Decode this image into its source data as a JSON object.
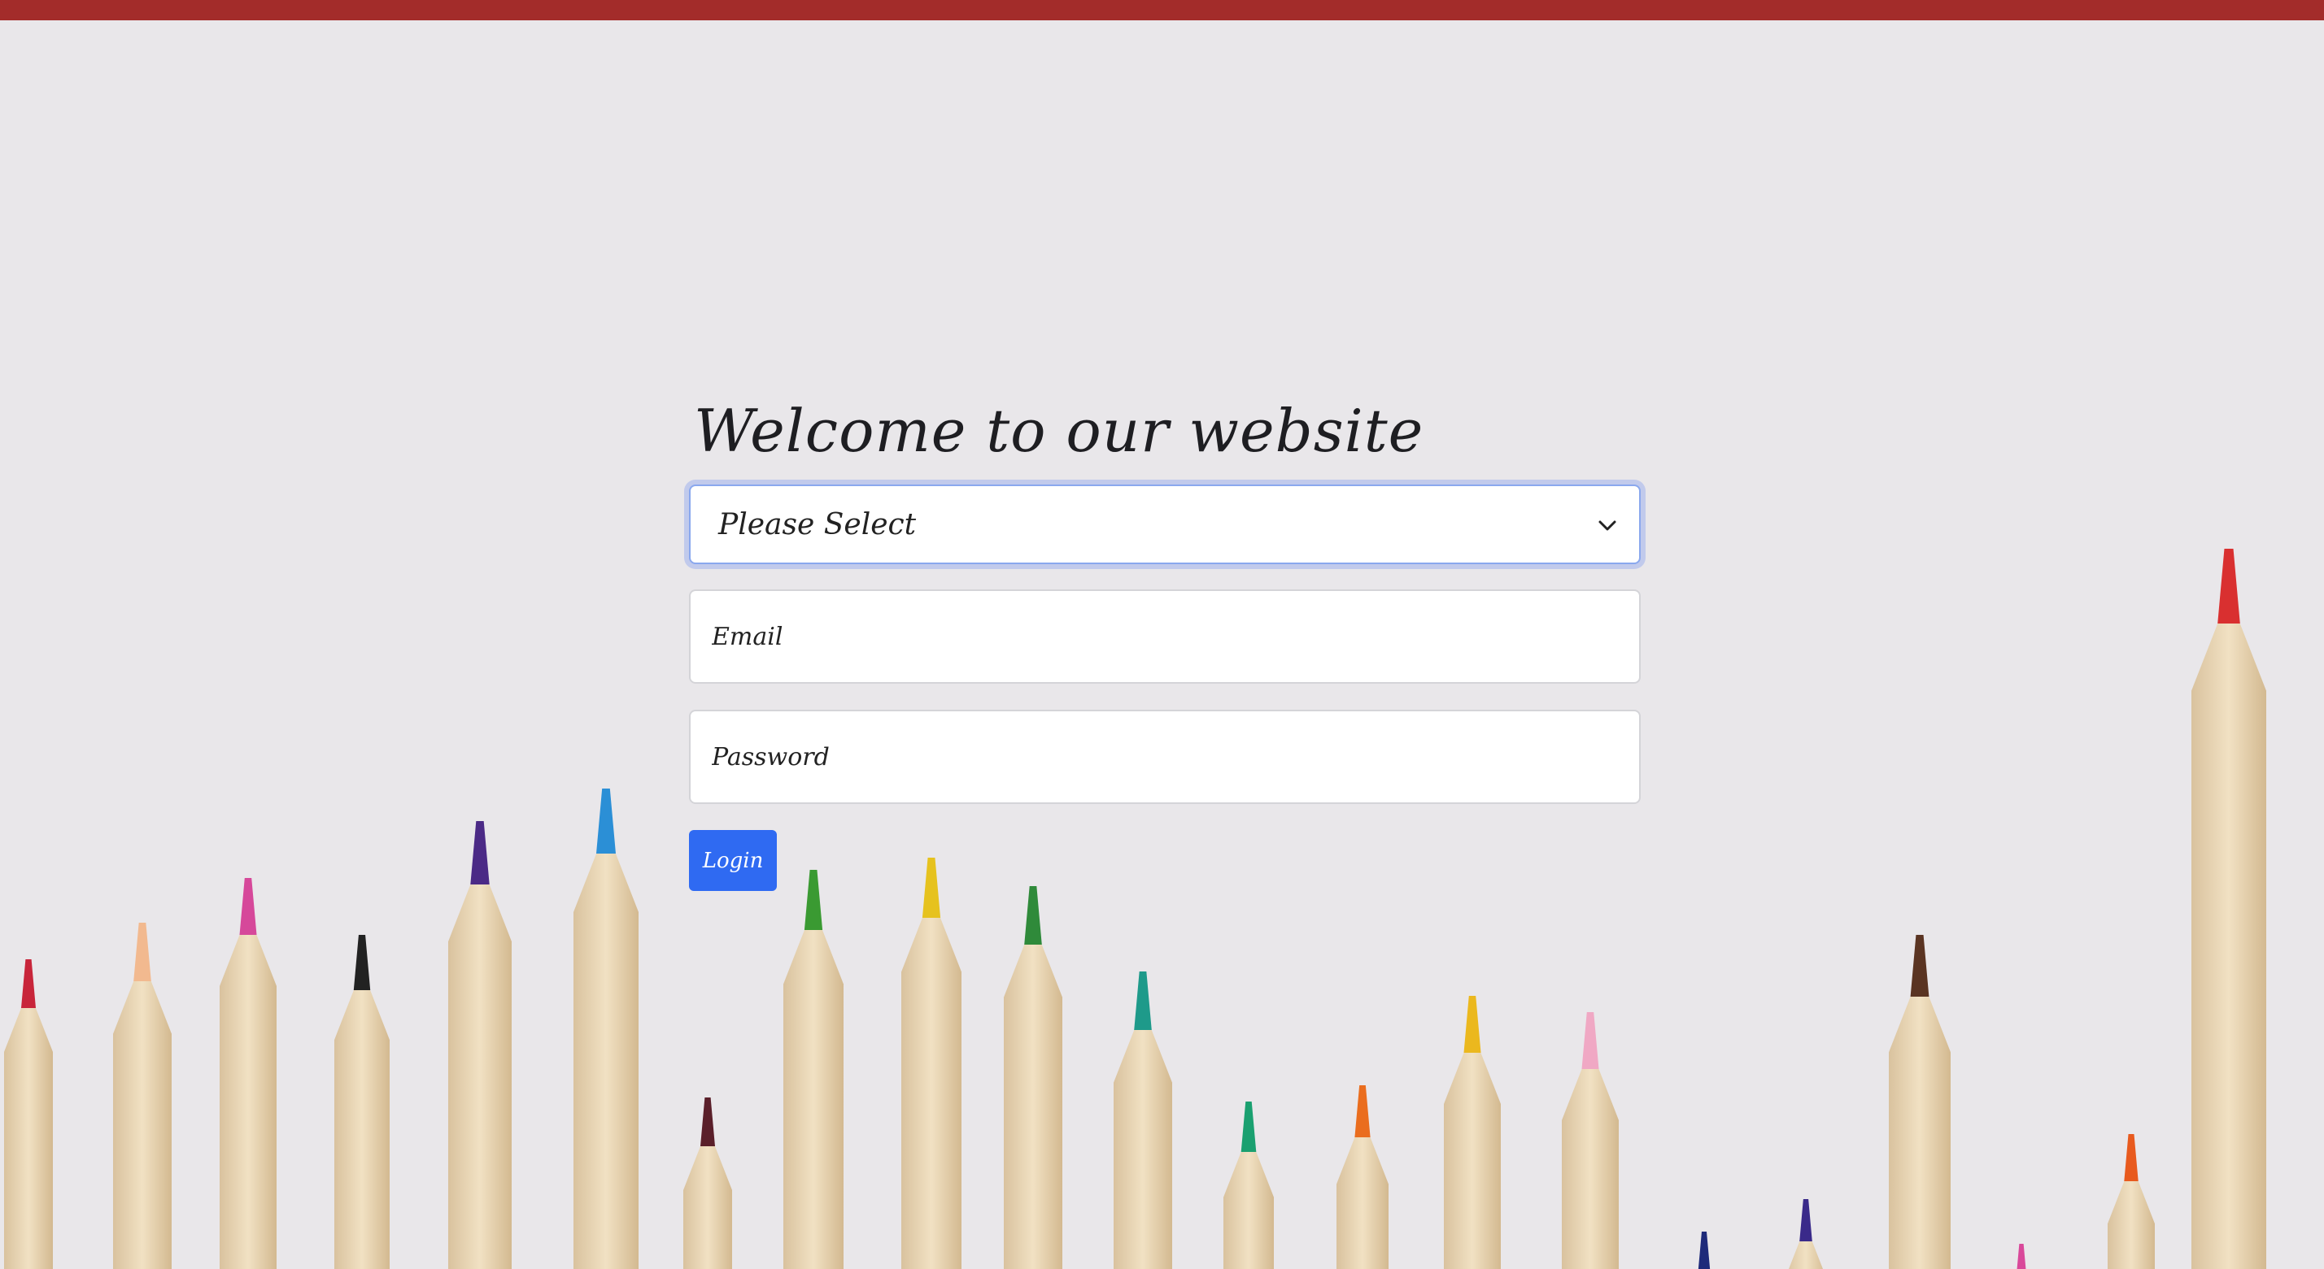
{
  "page": {
    "title": "Welcome to our website"
  },
  "form": {
    "role_select": {
      "value": "Please Select"
    },
    "email": {
      "placeholder": "Email",
      "value": ""
    },
    "password": {
      "placeholder": "Password",
      "value": ""
    },
    "login_label": "Login"
  },
  "icons": {
    "select_arrow": "chevron-down-icon"
  },
  "colors": {
    "top_bar": "#a32c2a",
    "background": "#e9e7ea",
    "button": "#2f6af2",
    "focus_ring": "#8aa8ee"
  }
}
